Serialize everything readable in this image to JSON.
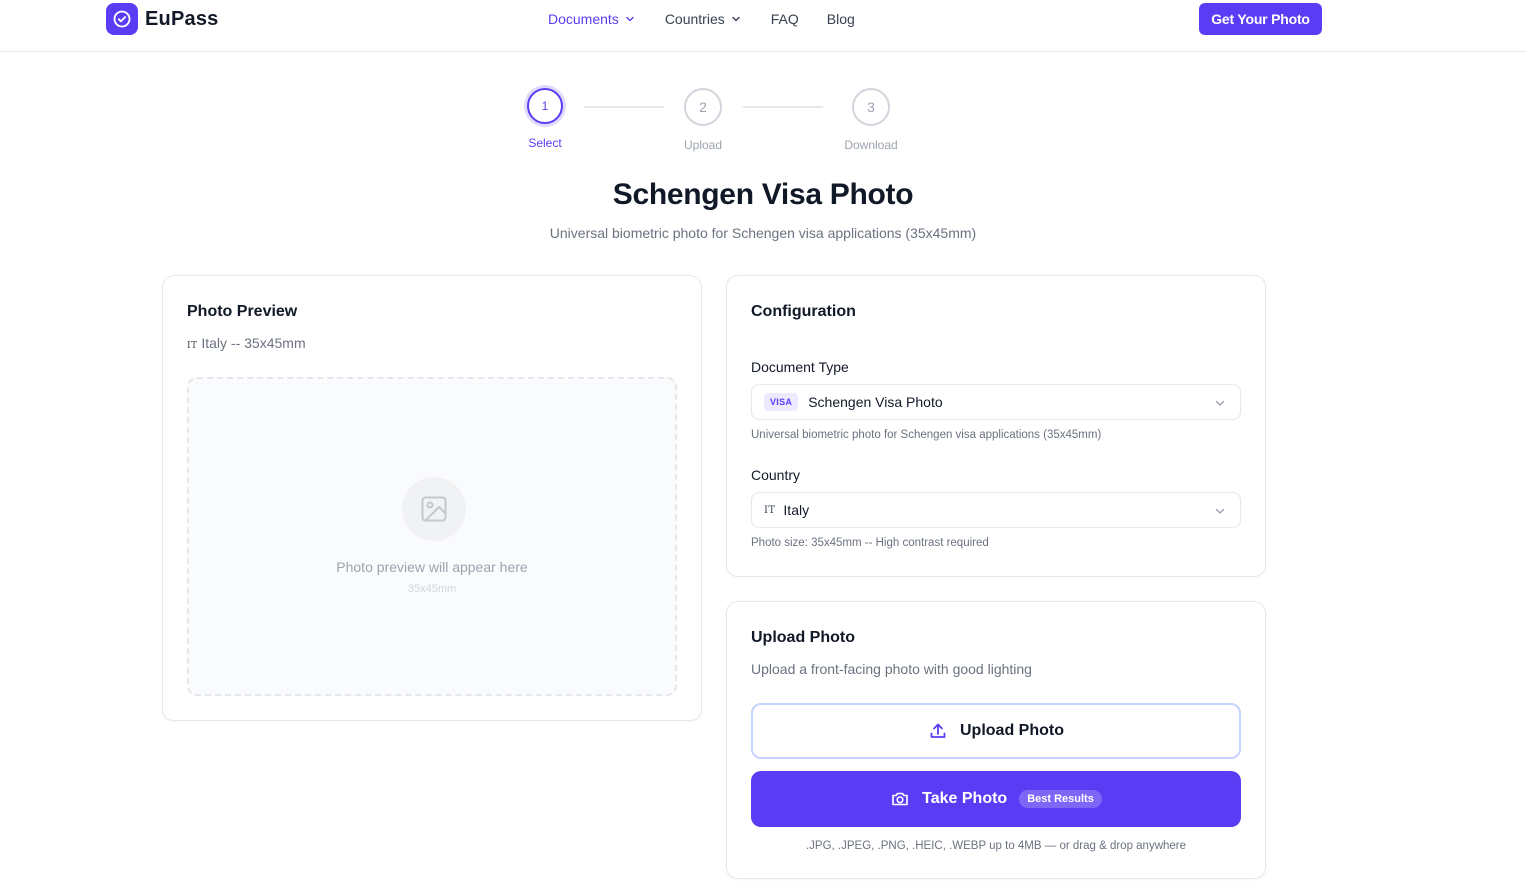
{
  "header": {
    "brand": "EuPass",
    "nav": [
      {
        "label": "Documents"
      },
      {
        "label": "Countries"
      },
      {
        "label": "FAQ"
      },
      {
        "label": "Blog"
      }
    ],
    "cta_label": "Get Your Photo"
  },
  "stepper": {
    "steps": [
      {
        "number": "1",
        "label": "Select",
        "active": true
      },
      {
        "number": "2",
        "label": "Upload",
        "active": false
      },
      {
        "number": "3",
        "label": "Download",
        "active": false
      }
    ]
  },
  "page": {
    "title": "Schengen Visa Photo",
    "subtitle": "Universal biometric photo for Schengen visa applications (35x45mm)"
  },
  "preview": {
    "title": "Photo Preview",
    "flag_code": "IT",
    "subtitle": "Italy -- 35x45mm",
    "placeholder_text": "Photo preview will appear here",
    "placeholder_dim": "35x45mm",
    "placeholder_icon": "image-icon"
  },
  "config": {
    "title": "Configuration",
    "document_type": {
      "label": "Document Type",
      "badge": "VISA",
      "value": "Schengen Visa Photo",
      "help": "Universal biometric photo for Schengen visa applications (35x45mm)"
    },
    "country": {
      "label": "Country",
      "flag_code": "IT",
      "value": "Italy",
      "help": "Photo size: 35x45mm -- High contrast required"
    }
  },
  "upload": {
    "title": "Upload Photo",
    "subtitle": "Upload a front-facing photo with good lighting",
    "upload_label": "Upload Photo",
    "take_label": "Take Photo",
    "take_badge": "Best Results",
    "formats": ".JPG, .JPEG, .PNG, .HEIC, .WEBP up to 4MB — or drag & drop anywhere"
  },
  "colors": {
    "accent": "#5b3cf5",
    "text": "#111827",
    "muted": "#6b7280",
    "border": "#e5e7eb"
  }
}
